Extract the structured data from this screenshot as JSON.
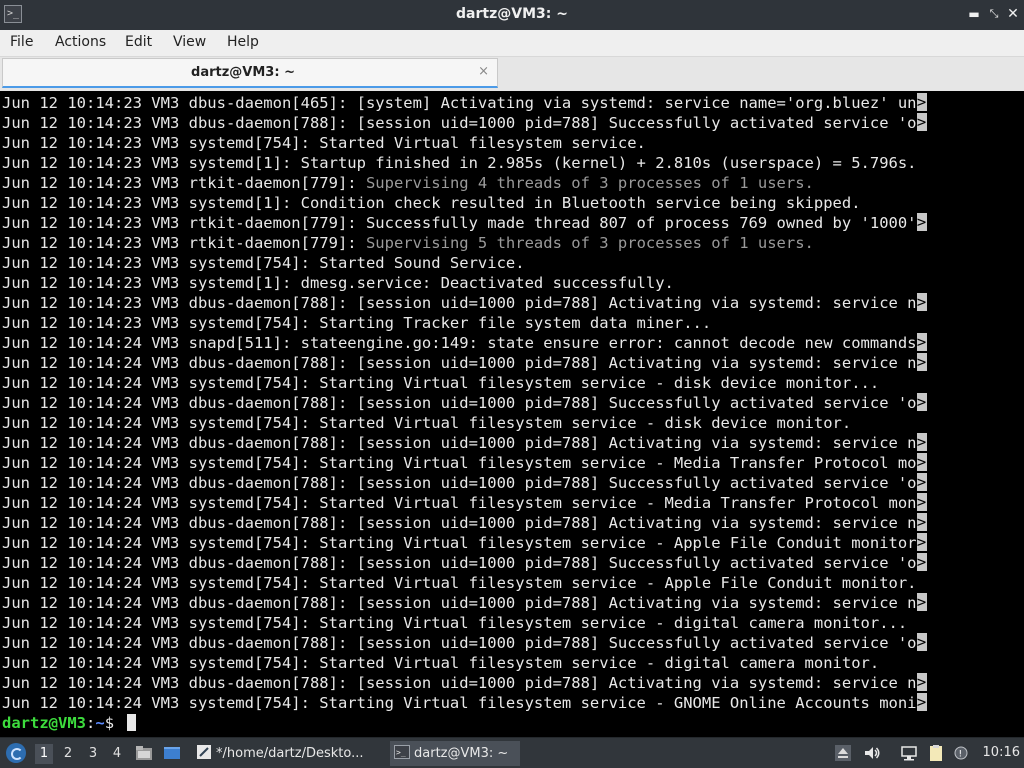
{
  "window": {
    "title": "dartz@VM3: ~",
    "controls": [
      "minimize-icon",
      "maximize-icon",
      "close-icon"
    ]
  },
  "menubar": {
    "items": [
      "File",
      "Actions",
      "Edit",
      "View",
      "Help"
    ]
  },
  "tab": {
    "label": "dartz@VM3: ~",
    "close_icon": "×"
  },
  "terminal": {
    "lines": [
      {
        "text": "Jun 12 10:14:23 VM3 dbus-daemon[465]: [system] Activating via systemd: service name='org.bluez' un",
        "trunc": true
      },
      {
        "text": "Jun 12 10:14:23 VM3 dbus-daemon[788]: [session uid=1000 pid=788] Successfully activated service 'o",
        "trunc": true
      },
      {
        "text": "Jun 12 10:14:23 VM3 systemd[754]: Started Virtual filesystem service.",
        "trunc": false
      },
      {
        "text": "Jun 12 10:14:23 VM3 systemd[1]: Startup finished in 2.985s (kernel) + 2.810s (userspace) = 5.796s.",
        "trunc": false
      },
      {
        "text": "Jun 12 10:14:23 VM3 rtkit-daemon[779]: ",
        "dim": "Supervising 4 threads of 3 processes of 1 users.",
        "trunc": false
      },
      {
        "text": "Jun 12 10:14:23 VM3 systemd[1]: Condition check resulted in Bluetooth service being skipped.",
        "trunc": false
      },
      {
        "text": "Jun 12 10:14:23 VM3 rtkit-daemon[779]: Successfully made thread 807 of process 769 owned by '1000'",
        "trunc": true
      },
      {
        "text": "Jun 12 10:14:23 VM3 rtkit-daemon[779]: ",
        "dim": "Supervising 5 threads of 3 processes of 1 users.",
        "trunc": false
      },
      {
        "text": "Jun 12 10:14:23 VM3 systemd[754]: Started Sound Service.",
        "trunc": false
      },
      {
        "text": "Jun 12 10:14:23 VM3 systemd[1]: dmesg.service: Deactivated successfully.",
        "trunc": false
      },
      {
        "text": "Jun 12 10:14:23 VM3 dbus-daemon[788]: [session uid=1000 pid=788] Activating via systemd: service n",
        "trunc": true
      },
      {
        "text": "Jun 12 10:14:23 VM3 systemd[754]: Starting Tracker file system data miner...",
        "trunc": false
      },
      {
        "text": "Jun 12 10:14:24 VM3 snapd[511]: stateengine.go:149: state ensure error: cannot decode new commands",
        "trunc": true
      },
      {
        "text": "Jun 12 10:14:24 VM3 dbus-daemon[788]: [session uid=1000 pid=788] Activating via systemd: service n",
        "trunc": true
      },
      {
        "text": "Jun 12 10:14:24 VM3 systemd[754]: Starting Virtual filesystem service - disk device monitor...",
        "trunc": false
      },
      {
        "text": "Jun 12 10:14:24 VM3 dbus-daemon[788]: [session uid=1000 pid=788] Successfully activated service 'o",
        "trunc": true
      },
      {
        "text": "Jun 12 10:14:24 VM3 systemd[754]: Started Virtual filesystem service - disk device monitor.",
        "trunc": false
      },
      {
        "text": "Jun 12 10:14:24 VM3 dbus-daemon[788]: [session uid=1000 pid=788] Activating via systemd: service n",
        "trunc": true
      },
      {
        "text": "Jun 12 10:14:24 VM3 systemd[754]: Starting Virtual filesystem service - Media Transfer Protocol mo",
        "trunc": true
      },
      {
        "text": "Jun 12 10:14:24 VM3 dbus-daemon[788]: [session uid=1000 pid=788] Successfully activated service 'o",
        "trunc": true
      },
      {
        "text": "Jun 12 10:14:24 VM3 systemd[754]: Started Virtual filesystem service - Media Transfer Protocol mon",
        "trunc": true
      },
      {
        "text": "Jun 12 10:14:24 VM3 dbus-daemon[788]: [session uid=1000 pid=788] Activating via systemd: service n",
        "trunc": true
      },
      {
        "text": "Jun 12 10:14:24 VM3 systemd[754]: Starting Virtual filesystem service - Apple File Conduit monitor",
        "trunc": true
      },
      {
        "text": "Jun 12 10:14:24 VM3 dbus-daemon[788]: [session uid=1000 pid=788] Successfully activated service 'o",
        "trunc": true
      },
      {
        "text": "Jun 12 10:14:24 VM3 systemd[754]: Started Virtual filesystem service - Apple File Conduit monitor.",
        "trunc": false
      },
      {
        "text": "Jun 12 10:14:24 VM3 dbus-daemon[788]: [session uid=1000 pid=788] Activating via systemd: service n",
        "trunc": true
      },
      {
        "text": "Jun 12 10:14:24 VM3 systemd[754]: Starting Virtual filesystem service - digital camera monitor...",
        "trunc": false
      },
      {
        "text": "Jun 12 10:14:24 VM3 dbus-daemon[788]: [session uid=1000 pid=788] Successfully activated service 'o",
        "trunc": true
      },
      {
        "text": "Jun 12 10:14:24 VM3 systemd[754]: Started Virtual filesystem service - digital camera monitor.",
        "trunc": false
      },
      {
        "text": "Jun 12 10:14:24 VM3 dbus-daemon[788]: [session uid=1000 pid=788] Activating via systemd: service n",
        "trunc": true
      },
      {
        "text": "Jun 12 10:14:24 VM3 systemd[754]: Starting Virtual filesystem service - GNOME Online Accounts moni",
        "trunc": true
      }
    ],
    "truncation_marker": ">",
    "prompt": {
      "user": "dartz@VM3",
      "sep": ":",
      "path": "~",
      "symbol": "$ "
    }
  },
  "taskbar": {
    "workspaces": [
      "1",
      "2",
      "3",
      "4"
    ],
    "active_workspace": "1",
    "tasks": [
      {
        "label": "*/home/dartz/Deskto...",
        "icon": "text-editor-icon",
        "active": false
      },
      {
        "label": "dartz@VM3: ~",
        "icon": "terminal-icon",
        "active": true
      }
    ],
    "clock": "10:16"
  },
  "colors": {
    "terminal_bg": "#000000",
    "prompt_user": "#3ddc3d",
    "prompt_path": "#5c8bff",
    "tab_accent": "#4c9be8"
  }
}
